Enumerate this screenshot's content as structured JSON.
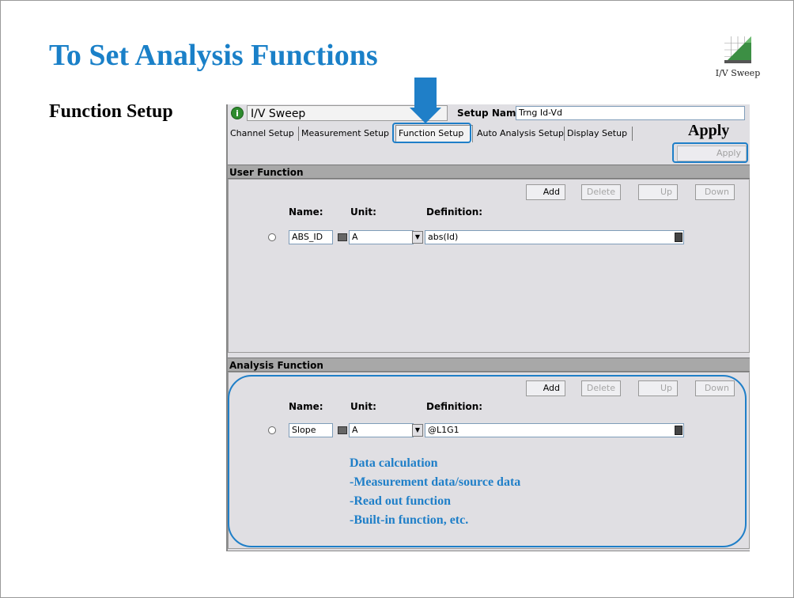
{
  "slide": {
    "title": "To Set Analysis Functions",
    "section": "Function Setup",
    "apply_callout": "Apply",
    "top_icon_label": "I/V Sweep",
    "notes": [
      "Data calculation",
      "-Measurement data/source data",
      "-Read out function",
      "-Built-in function, etc."
    ]
  },
  "window": {
    "title": "I/V Sweep",
    "setup_name_label": "Setup Name:",
    "setup_name_value": "Trng Id-Vd",
    "tabs": [
      {
        "label": "Channel Setup"
      },
      {
        "label": "Measurement Setup"
      },
      {
        "label": "Function Setup",
        "active": true
      },
      {
        "label": "Auto Analysis Setup"
      },
      {
        "label": "Display Setup"
      }
    ],
    "apply_label": "Apply"
  },
  "user_function": {
    "header": "User Function",
    "buttons": {
      "add": "Add",
      "delete": "Delete",
      "up": "Up",
      "down": "Down"
    },
    "columns": {
      "name": "Name:",
      "unit": "Unit:",
      "definition": "Definition:"
    },
    "row": {
      "name": "ABS_ID",
      "unit": "A",
      "definition": "abs(Id)"
    }
  },
  "analysis_function": {
    "header": "Analysis Function",
    "buttons": {
      "add": "Add",
      "delete": "Delete",
      "up": "Up",
      "down": "Down"
    },
    "columns": {
      "name": "Name:",
      "unit": "Unit:",
      "definition": "Definition:"
    },
    "row": {
      "name": "Slope",
      "unit": "A",
      "definition": "@L1G1"
    }
  },
  "colors": {
    "accent": "#1f7fc8",
    "title": "#1a80c8"
  }
}
